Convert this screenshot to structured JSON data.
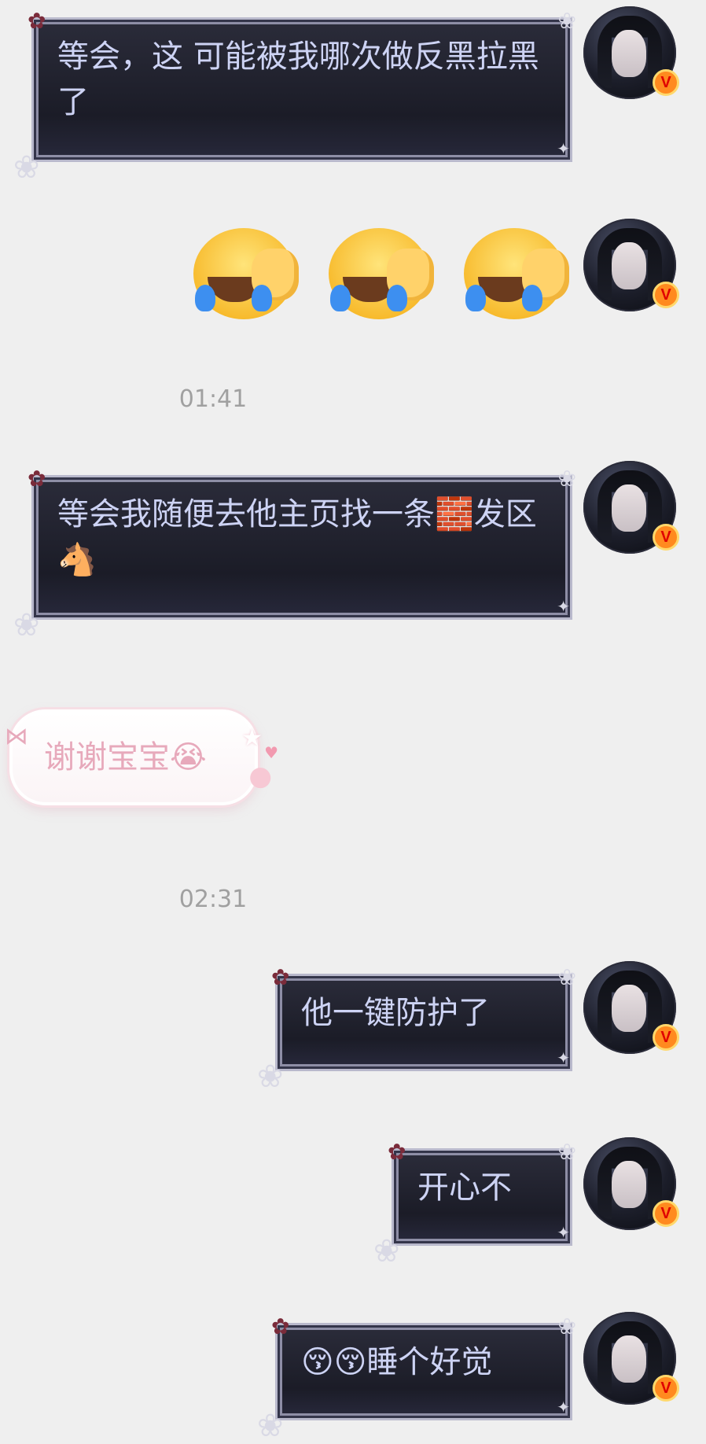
{
  "messages": [
    {
      "id": "m1",
      "text": "等会，这        可能被我哪次做反黑拉黑了"
    },
    {
      "id": "m2",
      "emoji": "🤦"
    },
    {
      "id": "m3",
      "text": "等会我随便去他主页找一条🧱发区🐴"
    },
    {
      "id": "m4",
      "text": "谢谢宝宝😭"
    },
    {
      "id": "m5",
      "text": "他一键防护了"
    },
    {
      "id": "m6",
      "text": "开心不"
    },
    {
      "id": "m7",
      "text": "😚😚睡个好觉"
    }
  ],
  "timestamps": [
    "01:41",
    "02:31"
  ],
  "avatar": {
    "badge": "V",
    "badge_color": "#ff8a1f"
  },
  "colors": {
    "background": "#efefef",
    "dark_bubble_text": "#cdd3f4",
    "pink_bubble_text": "#e7a9bb"
  },
  "icons": {
    "dark_bubble_corners": [
      "flower-icon",
      "lily-icon",
      "star-icon"
    ],
    "pink_bubble_decor": [
      "bow-icon",
      "star-icon",
      "heart-icon",
      "paw-icon"
    ]
  }
}
